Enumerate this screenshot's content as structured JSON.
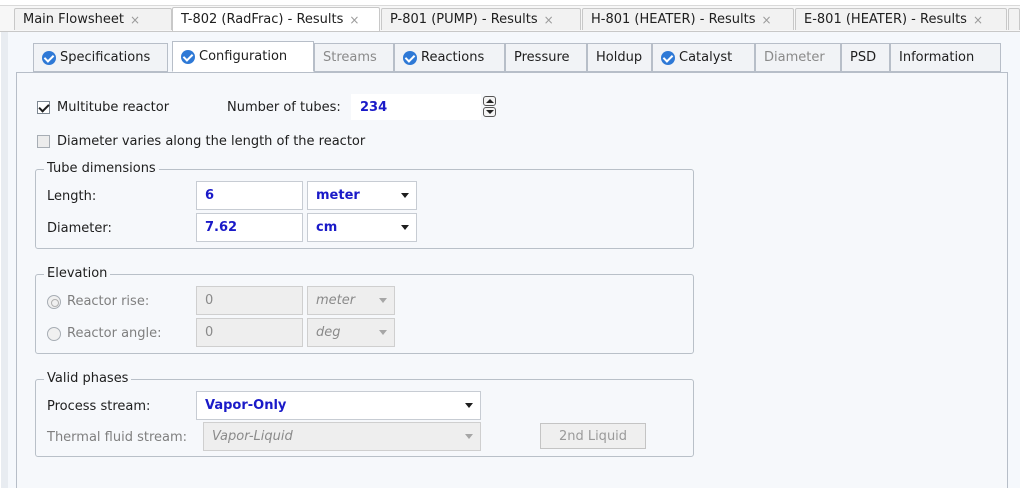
{
  "document_tabs": [
    {
      "label": "Main Flowsheet",
      "close": "×"
    },
    {
      "label": "T-802 (RadFrac) - Results",
      "close": "×"
    },
    {
      "label": "P-801 (PUMP) - Results",
      "close": "×"
    },
    {
      "label": "H-801 (HEATER) - Results",
      "close": "×"
    },
    {
      "label": "E-801 (HEATER) - Results",
      "close": "×"
    }
  ],
  "form_tabs": [
    {
      "label": "Specifications",
      "icon": "check-circle-icon",
      "state": "complete"
    },
    {
      "label": "Configuration",
      "icon": "check-circle-icon",
      "state": "active"
    },
    {
      "label": "Streams",
      "state": "disabled"
    },
    {
      "label": "Reactions",
      "icon": "check-circle-icon",
      "state": "complete"
    },
    {
      "label": "Pressure",
      "state": "normal"
    },
    {
      "label": "Holdup",
      "state": "normal"
    },
    {
      "label": "Catalyst",
      "icon": "check-circle-icon",
      "state": "complete"
    },
    {
      "label": "Diameter",
      "state": "disabled"
    },
    {
      "label": "PSD",
      "state": "normal"
    },
    {
      "label": "Information",
      "state": "normal"
    }
  ],
  "configuration": {
    "multitube": {
      "label": "Multitube reactor",
      "checked": true
    },
    "number_of_tubes": {
      "label": "Number of tubes:",
      "value": "234"
    },
    "diameter_varies": {
      "label": "Diameter varies along the length of the reactor",
      "checked": false
    },
    "tube_dimensions": {
      "title": "Tube dimensions",
      "length": {
        "label": "Length:",
        "value": "6",
        "unit": "meter"
      },
      "diameter": {
        "label": "Diameter:",
        "value": "7.62",
        "unit": "cm"
      }
    },
    "elevation": {
      "title": "Elevation",
      "reactor_rise": {
        "label": "Reactor rise:",
        "value": "0",
        "unit": "meter"
      },
      "reactor_angle": {
        "label": "Reactor angle:",
        "value": "0",
        "unit": "deg"
      }
    },
    "valid_phases": {
      "title": "Valid phases",
      "process_stream": {
        "label": "Process stream:",
        "value": "Vapor-Only"
      },
      "thermal_fluid_stream": {
        "label": "Thermal fluid stream:",
        "value": "Vapor-Liquid"
      },
      "second_liquid_button": "2nd Liquid"
    }
  },
  "colors": {
    "accent_blue_text": "#1a1ac8",
    "check_icon": "#2e79d6"
  }
}
